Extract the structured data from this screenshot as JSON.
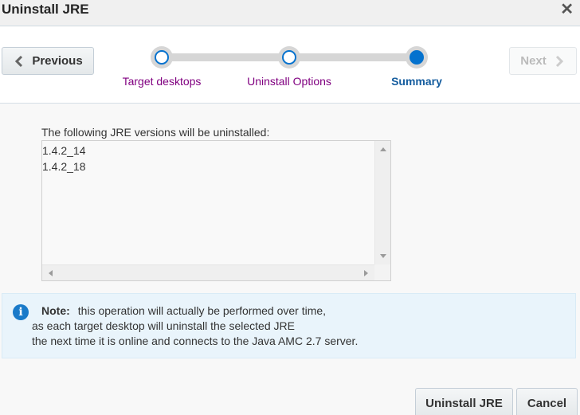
{
  "dialog": {
    "title": "Uninstall JRE",
    "close_icon": "close-icon"
  },
  "train": {
    "previous_label": "Previous",
    "next_label": "Next",
    "next_enabled": false,
    "steps": [
      {
        "label": "Target desktops",
        "state": "visited"
      },
      {
        "label": "Uninstall Options",
        "state": "visited"
      },
      {
        "label": "Summary",
        "state": "current"
      }
    ],
    "colors": {
      "visited_label": "#800080",
      "current_label": "#145c9e",
      "stop_accent": "#0572ce"
    }
  },
  "summary": {
    "list_label": "The following JRE versions will be uninstalled:",
    "versions": [
      "1.4.2_14",
      "1.4.2_18"
    ]
  },
  "note": {
    "icon": "info-icon",
    "label": "Note:",
    "lines": [
      "this operation will actually be performed over time,",
      "as each target desktop will uninstall the selected JRE",
      "the next time it is online and connects to the Java AMC 2.7 server."
    ]
  },
  "footer": {
    "uninstall_label": "Uninstall JRE",
    "cancel_label": "Cancel"
  }
}
